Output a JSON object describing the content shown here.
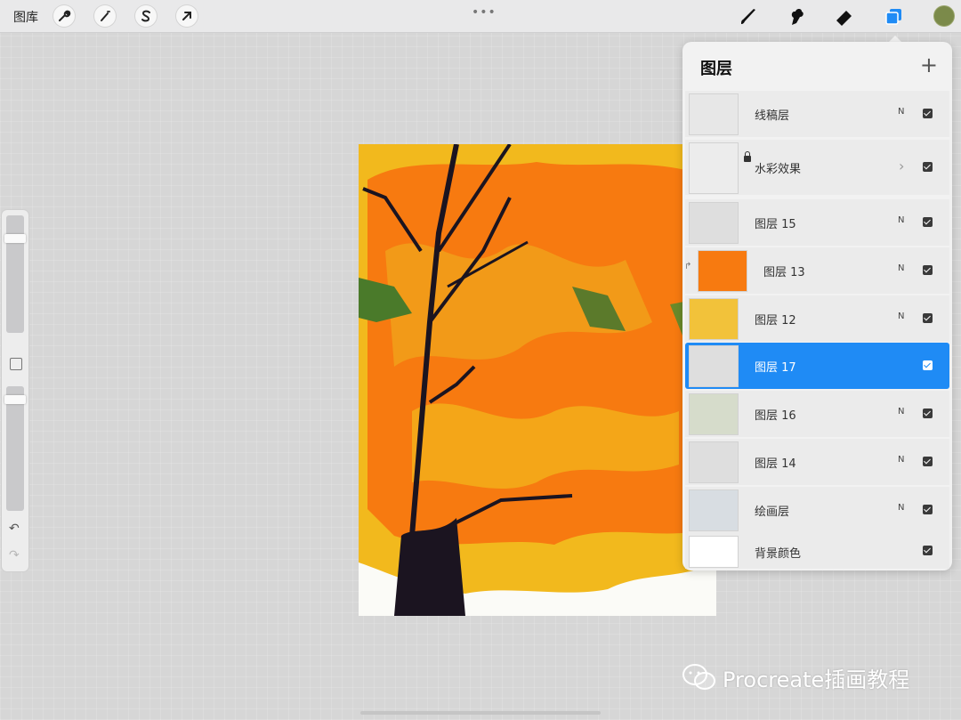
{
  "topbar": {
    "gallery_label": "图库",
    "left_tools": [
      "wrench-icon",
      "magic-wand-icon",
      "selection-s-icon",
      "transform-arrow-icon"
    ],
    "right_tools": [
      "brush-icon",
      "smudge-icon",
      "eraser-icon",
      "layers-icon"
    ],
    "current_color": "#7b8a4a",
    "more_dots": "•••"
  },
  "sidebar": {
    "undo_icon": "↶",
    "redo_icon": "↷"
  },
  "layers_panel": {
    "title": "图层",
    "add_icon": "+",
    "layers": [
      {
        "name": "线稿层",
        "mode": "N",
        "visible": true
      },
      {
        "name": "水彩效果",
        "mode": "",
        "visible": true,
        "locked": true,
        "group": true
      },
      {
        "name": "图层 15",
        "mode": "N",
        "visible": true
      },
      {
        "name": "图层 13",
        "mode": "N",
        "visible": true,
        "clipped": true
      },
      {
        "name": "图层 12",
        "mode": "N",
        "visible": true
      },
      {
        "name": "图层 17",
        "mode": "",
        "visible": true,
        "selected": true
      },
      {
        "name": "图层 16",
        "mode": "N",
        "visible": true
      },
      {
        "name": "图层 14",
        "mode": "N",
        "visible": true
      },
      {
        "name": "绘画层",
        "mode": "N",
        "visible": true
      },
      {
        "name": "背景颜色",
        "mode": "",
        "visible": true
      }
    ]
  },
  "watermark": {
    "text": "Procreate插画教程"
  },
  "colors": {
    "accent": "#1f8bf5",
    "artwork_orange": "#f77a10",
    "artwork_yellow": "#f2b91d",
    "artwork_green": "#4a7a2a",
    "trunk": "#1b1420"
  }
}
